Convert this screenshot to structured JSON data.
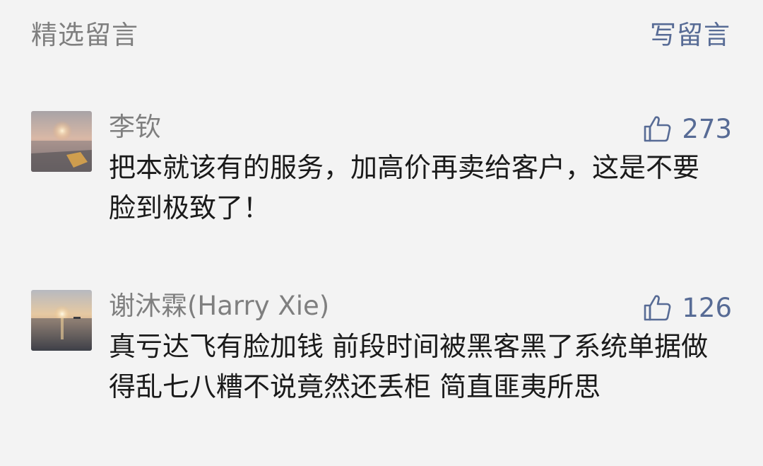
{
  "header": {
    "title": "精选留言",
    "write_label": "写留言"
  },
  "comments": [
    {
      "author": "李钦",
      "likes": "273",
      "text": "把本就该有的服务，加高价再卖给客户，这是不要脸到极致了！"
    },
    {
      "author": "谢沐霖(Harry Xie)",
      "likes": "126",
      "text": "真亏达飞有脸加钱 前段时间被黑客黑了系统单据做得乱七八糟不说竟然还丢柜 简直匪夷所思"
    }
  ],
  "colors": {
    "link": "#576b95",
    "muted": "#7f7f7f",
    "background": "#f3f3f3"
  },
  "icons": {
    "like": "thumbs-up-icon"
  }
}
